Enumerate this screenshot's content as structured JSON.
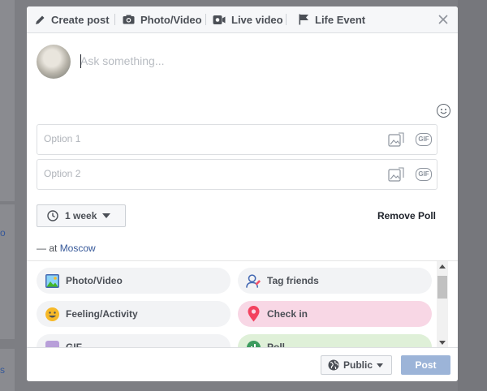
{
  "background": {
    "left_fragments": [
      "o",
      "s"
    ]
  },
  "tabs": [
    {
      "label": "Create post",
      "icon": "pencil-icon"
    },
    {
      "label": "Photo/Video",
      "icon": "camera-icon"
    },
    {
      "label": "Live video",
      "icon": "live-video-icon"
    },
    {
      "label": "Life Event",
      "icon": "flag-icon"
    }
  ],
  "composer": {
    "placeholder": "Ask something..."
  },
  "poll": {
    "options": [
      {
        "placeholder": "Option 1"
      },
      {
        "placeholder": "Option 2"
      }
    ],
    "duration": "1 week",
    "remove_label": "Remove Poll"
  },
  "location": {
    "prefix": "— at",
    "name": "Moscow"
  },
  "actions": [
    {
      "label": "Photo/Video",
      "icon": "photo-icon"
    },
    {
      "label": "Tag friends",
      "icon": "tag-friends-icon"
    },
    {
      "label": "Feeling/Activity",
      "icon": "smiley-icon"
    },
    {
      "label": "Check in",
      "icon": "location-pin-icon"
    },
    {
      "label": "GIF",
      "icon": "gif-icon"
    },
    {
      "label": "Poll",
      "icon": "poll-icon"
    }
  ],
  "footer": {
    "audience": "Public",
    "post_label": "Post"
  },
  "colors": {
    "link": "#365899",
    "post_button_disabled": "#9cb4d8",
    "checkin_bg": "#f8d7e5",
    "poll_bg": "#dff0d8"
  }
}
